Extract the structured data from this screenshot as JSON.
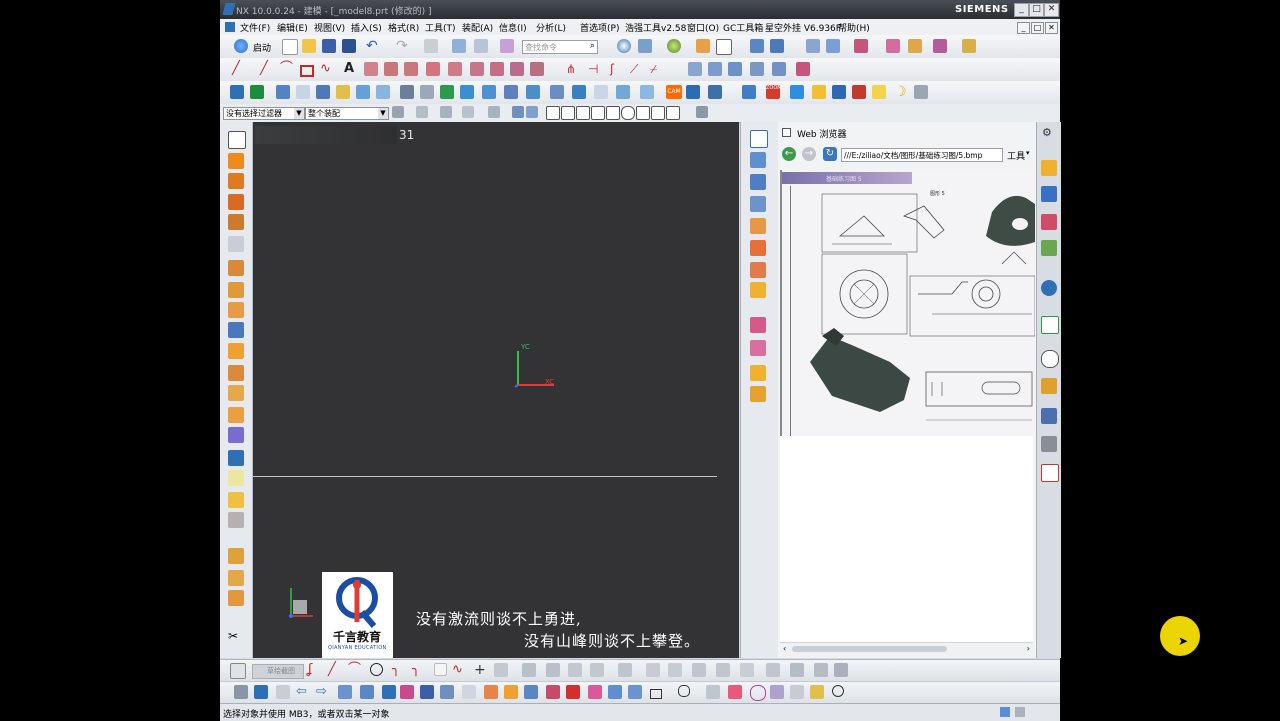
{
  "titlebar": {
    "title": "NX 10.0.0.24 - 建模 - [_model8.prt  (修改的) ]",
    "brand": "SIEMENS",
    "controls": [
      "_",
      "□",
      "✕"
    ]
  },
  "menubar": {
    "items": [
      "文件(F)",
      "编辑(E)",
      "视图(V)",
      "插入(S)",
      "格式(R)",
      "工具(T)",
      "装配(A)",
      "信息(I)",
      "分析(L)",
      "首选项(P)",
      "浩强工具v2.58",
      "窗口(O)",
      "GC工具箱",
      "星空外挂 V6.936F",
      "帮助(H)"
    ],
    "controls": [
      "_",
      "□",
      "✕"
    ]
  },
  "toolbar1": {
    "start_label": "启动",
    "search_placeholder": "查找命令"
  },
  "selectionbar": {
    "filter_value": "没有选择过滤器",
    "scope_value": "整个装配"
  },
  "viewport": {
    "counter": "31",
    "axis_labels": {
      "y": "YC",
      "x": "XC"
    },
    "subtitle_line1": "没有激流则谈不上勇进,",
    "subtitle_line2": "没有山峰则谈不上攀登。",
    "logo_text": "千言教育",
    "logo_sub": "QIANYAN EDUCATION"
  },
  "browser": {
    "title": "Web 浏览器",
    "address": "///E:/ziliao/文档/图形/基础练习图/5.bmp",
    "tools_label": "工具",
    "image_header": "基础练习图 5",
    "drawing_label": "图形 5"
  },
  "bottombar": {
    "selector_label": "草绘截图"
  },
  "status": {
    "text": "选择对象并使用 MB3，或者双击某一对象"
  },
  "colors": {
    "viewport_bg": "#333335",
    "chrome_bg": "#d6dbe2",
    "titlebar_bg": "#2a2d33",
    "cursor_highlight": "#ffe600"
  }
}
